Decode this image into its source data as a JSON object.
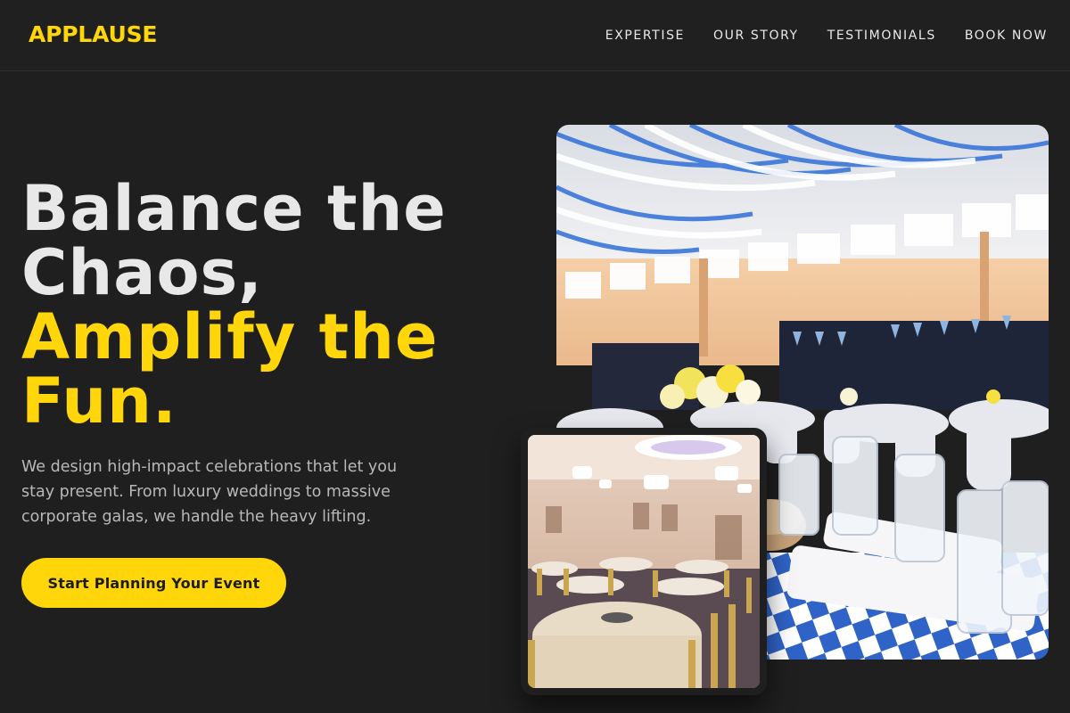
{
  "brand": {
    "name": "APPLAUSE"
  },
  "nav": {
    "items": [
      {
        "label": "EXPERTISE"
      },
      {
        "label": "OUR STORY"
      },
      {
        "label": "TESTIMONIALS"
      },
      {
        "label": "BOOK NOW"
      }
    ]
  },
  "hero": {
    "headline_line1": "Balance the",
    "headline_line2": "Chaos,",
    "headline_accent_line1": "Amplify the",
    "headline_accent_line2": "Fun.",
    "description": "We design high-impact celebrations that let you stay present. From luxury weddings to massive corporate galas, we handle the heavy lifting.",
    "cta_label": "Start Planning Your Event"
  },
  "colors": {
    "background": "#1f1f1f",
    "accent": "#ffd60a",
    "text_primary": "#e8e8e8",
    "text_secondary": "#b8b8b8"
  }
}
